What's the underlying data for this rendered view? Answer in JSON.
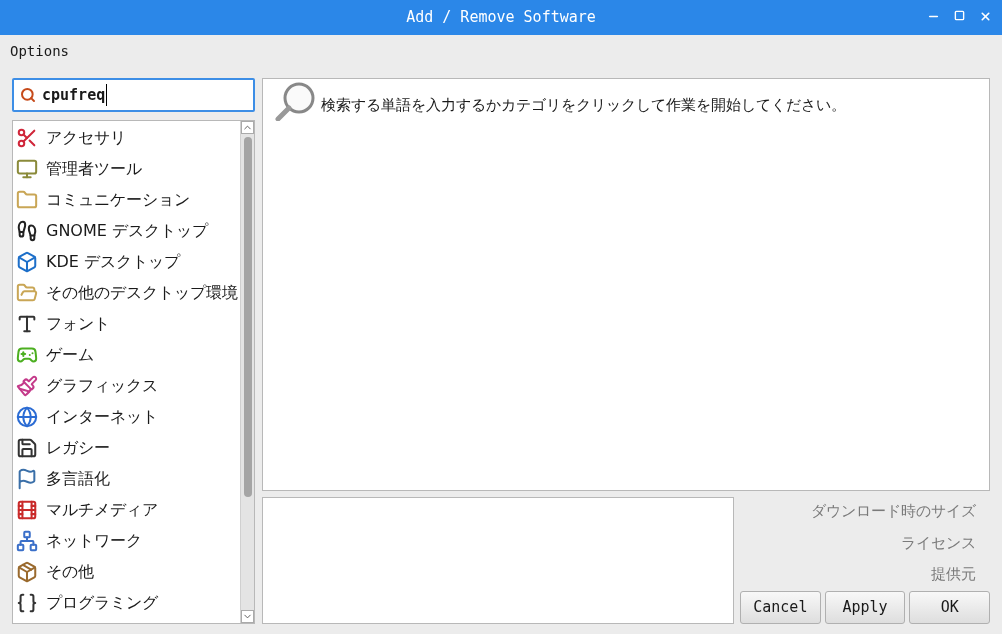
{
  "window": {
    "title": "Add / Remove Software"
  },
  "menu": [
    "Options"
  ],
  "search": {
    "value": "cpufreq"
  },
  "categories": [
    {
      "label": "アクセサリ"
    },
    {
      "label": "管理者ツール"
    },
    {
      "label": "コミュニケーション"
    },
    {
      "label": "GNOME デスクトップ"
    },
    {
      "label": "KDE デスクトップ"
    },
    {
      "label": "その他のデスクトップ環境"
    },
    {
      "label": "フォント"
    },
    {
      "label": "ゲーム"
    },
    {
      "label": "グラフィックス"
    },
    {
      "label": "インターネット"
    },
    {
      "label": "レガシー"
    },
    {
      "label": "多言語化"
    },
    {
      "label": "マルチメディア"
    },
    {
      "label": "ネットワーク"
    },
    {
      "label": "その他"
    },
    {
      "label": "プログラミング"
    }
  ],
  "results": {
    "message": "検索する単語を入力するかカテゴリをクリックして作業を開始してください。"
  },
  "details": {
    "labels": [
      "ダウンロード時のサイズ",
      "ライセンス",
      "提供元"
    ]
  },
  "buttons": [
    "Cancel",
    "Apply",
    "OK"
  ]
}
